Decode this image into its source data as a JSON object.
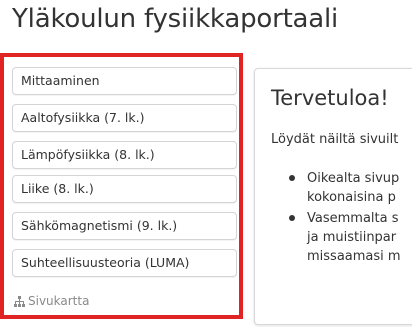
{
  "header": {
    "title": "Yläkoulun fysiikkaportaali"
  },
  "nav": {
    "items": [
      {
        "label": "Mittaaminen"
      },
      {
        "label": "Aaltofysiikka (7. lk.)"
      },
      {
        "label": "Lämpöfysiikka (8. lk.)"
      },
      {
        "label": "Liike (8. lk.)"
      },
      {
        "label": "Sähkömagnetismi (9. lk.)"
      },
      {
        "label": "Suhteellisuusteoria (LUMA)"
      }
    ],
    "highlight_color": "#e02424",
    "sitemap_label": "Sivukartta",
    "sitemap_icon": "sitemap-icon"
  },
  "content": {
    "heading": "Tervetuloa!",
    "intro": "Löydät näiltä sivuilt",
    "bullets": [
      {
        "lines": [
          "Oikealta sivup",
          "kokonaisina p"
        ]
      },
      {
        "lines": [
          "Vasemmalta s",
          "ja muistiinpar",
          "missaamasi m"
        ]
      }
    ]
  }
}
